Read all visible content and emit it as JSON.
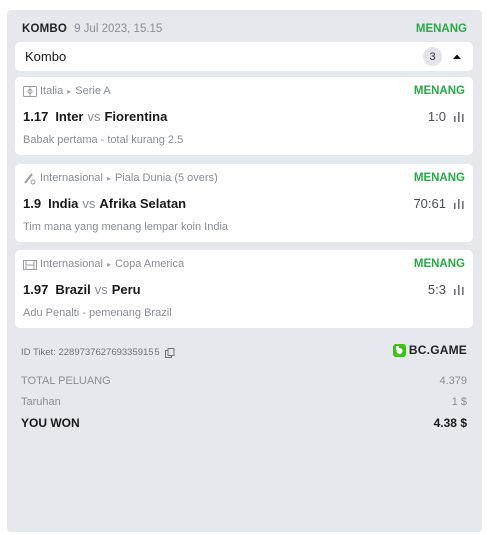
{
  "header": {
    "type": "KOMBO",
    "datetime": "9 Jul 2023, 15.15",
    "status": "MENANG"
  },
  "kombo": {
    "label": "Kombo",
    "count": "3"
  },
  "matches": [
    {
      "sport": "Italia",
      "league": "Serie A",
      "status": "MENANG",
      "odds": "1.17",
      "home": "Inter",
      "vs": "vs",
      "away": "Fiorentina",
      "score": "1:0",
      "market": "Babak pertama - total kurang 2.5",
      "icon": "football-icon"
    },
    {
      "sport": "Internasional",
      "league": "Piala Dunia (5 overs)",
      "status": "MENANG",
      "odds": "1.9",
      "home": "India",
      "vs": "vs",
      "away": "Afrika Selatan",
      "score": "70:61",
      "market": "Tim mana yang menang lempar koin India",
      "icon": "cricket-icon"
    },
    {
      "sport": "Internasional",
      "league": "Copa America",
      "status": "MENANG",
      "odds": "1.97",
      "home": "Brazil",
      "vs": "vs",
      "away": "Peru",
      "score": "5:3",
      "market": "Adu Penalti - pemenang Brazil",
      "icon": "penalty-icon"
    }
  ],
  "ticket": {
    "id_text": "ID Tiket: 228973762769335915 5",
    "brand": "BC.GAME"
  },
  "summary": {
    "total_odds_label": "TOTAL PELUANG",
    "total_odds_value": "4.379",
    "stake_label": "Taruhan",
    "stake_value": "1 $",
    "won_label": "YOU WON",
    "won_value": "4.38 $"
  },
  "colors": {
    "win_green": "#2aa84a",
    "brand_green": "#3bc117",
    "panel_bg": "#e7e8ec"
  }
}
